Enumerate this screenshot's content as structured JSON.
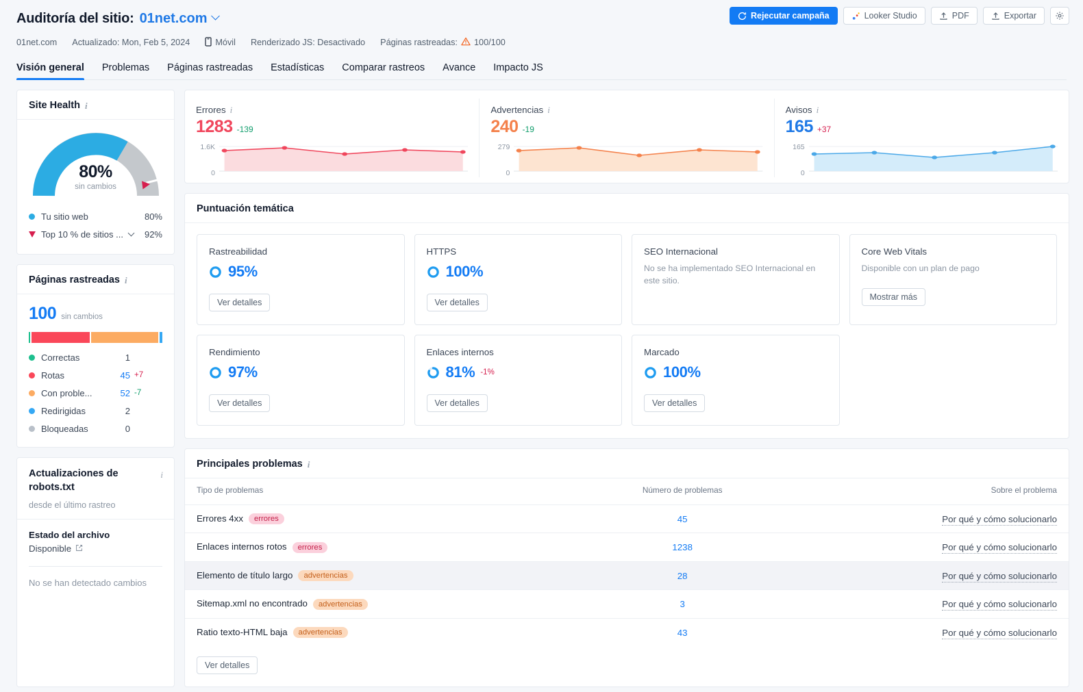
{
  "header": {
    "title": "Auditoría del sitio:",
    "domain": "01net.com",
    "meta": {
      "site": "01net.com",
      "updated": "Actualizado: Mon, Feb 5, 2024",
      "device": "Móvil",
      "js": "Renderizado JS: Desactivado",
      "crawled_label": "Páginas rastreadas:",
      "crawled_value": "100/100"
    },
    "toolbar": {
      "rerun": "Rejecutar campaña",
      "looker": "Looker Studio",
      "pdf": "PDF",
      "export": "Exportar"
    },
    "tabs": [
      {
        "label": "Visión general",
        "active": true
      },
      {
        "label": "Problemas",
        "active": false
      },
      {
        "label": "Páginas rastreadas",
        "active": false
      },
      {
        "label": "Estadísticas",
        "active": false
      },
      {
        "label": "Comparar rastreos",
        "active": false
      },
      {
        "label": "Avance",
        "active": false
      },
      {
        "label": "Impacto JS",
        "active": false
      }
    ]
  },
  "site_health": {
    "title": "Site Health",
    "value": "80%",
    "subtitle": "sin cambios",
    "percent": 80,
    "benchmark_percent": 92,
    "legend": [
      {
        "label": "Tu sitio web",
        "value": "80%",
        "color": "#2cace3",
        "marker": "dot"
      },
      {
        "label": "Top 10 % de sitios ...",
        "value": "92%",
        "color": "#d61f4e",
        "marker": "triangle"
      }
    ]
  },
  "crawled_pages": {
    "title": "Páginas rastreadas",
    "total": "100",
    "subtitle": "sin cambios",
    "segments": [
      {
        "label": "Correctas",
        "value": "1",
        "delta": "",
        "color": "#1dbf8e",
        "pct": 1
      },
      {
        "label": "Rotas",
        "value": "45",
        "delta": "+7",
        "delta_dir": "up",
        "color": "#fa4759",
        "pct": 45
      },
      {
        "label": "Con proble...",
        "value": "52",
        "delta": "-7",
        "delta_dir": "down",
        "color": "#fcab62",
        "pct": 52
      },
      {
        "label": "Redirigidas",
        "value": "2",
        "delta": "",
        "color": "#35a8f4",
        "pct": 2
      },
      {
        "label": "Bloqueadas",
        "value": "0",
        "delta": "",
        "color": "#b9c0c9",
        "pct": 0
      }
    ]
  },
  "robots": {
    "title": "Actualizaciones de robots.txt",
    "subtitle": "desde el último rastreo",
    "status_label": "Estado del archivo",
    "status_value": "Disponible",
    "note": "No se han detectado cambios"
  },
  "metrics": [
    {
      "label": "Errores",
      "value": "1283",
      "delta": "-139",
      "delta_dir": "down",
      "color": "#f0465c",
      "fill": "#fbdcdf",
      "axis_top": "1.6K",
      "axis_bottom": "0"
    },
    {
      "label": "Advertencias",
      "value": "240",
      "delta": "-19",
      "delta_dir": "down",
      "color": "#f4814b",
      "fill": "#fde4d1",
      "axis_top": "279",
      "axis_bottom": "0"
    },
    {
      "label": "Avisos",
      "value": "165",
      "delta": "+37",
      "delta_dir": "up",
      "color": "#4aa8e8",
      "fill": "#d4ecfa",
      "axis_top": "165",
      "axis_bottom": "0"
    }
  ],
  "chart_data": [
    {
      "type": "line",
      "title": "Errores",
      "ylabel": "",
      "xlabel": "",
      "ylim": [
        0,
        1600
      ],
      "tick_labels": [
        "1.6K",
        "0"
      ],
      "grid": false,
      "series": [
        {
          "name": "Errores",
          "values": [
            1400,
            1510,
            1300,
            1420,
            1283
          ],
          "color": "#f0465c"
        }
      ]
    },
    {
      "type": "line",
      "title": "Advertencias",
      "ylabel": "",
      "xlabel": "",
      "ylim": [
        0,
        279
      ],
      "tick_labels": [
        "279",
        "0"
      ],
      "grid": false,
      "series": [
        {
          "name": "Advertencias",
          "values": [
            249,
            262,
            215,
            250,
            240
          ],
          "color": "#f4814b"
        }
      ]
    },
    {
      "type": "line",
      "title": "Avisos",
      "ylabel": "",
      "xlabel": "",
      "ylim": [
        0,
        165
      ],
      "tick_labels": [
        "165",
        "0"
      ],
      "grid": false,
      "series": [
        {
          "name": "Avisos",
          "values": [
            118,
            126,
            92,
            124,
            165
          ],
          "color": "#4aa8e8"
        }
      ]
    }
  ],
  "themes": {
    "title": "Puntuación temática",
    "cards": [
      {
        "name": "Rastreabilidad",
        "score": "95%",
        "percent": 95,
        "delta": "",
        "button": "Ver detalles",
        "desc": ""
      },
      {
        "name": "HTTPS",
        "score": "100%",
        "percent": 100,
        "delta": "",
        "button": "Ver detalles",
        "desc": ""
      },
      {
        "name": "SEO Internacional",
        "score": "",
        "percent": 0,
        "delta": "",
        "button": "",
        "desc": "No se ha implementado SEO Internacional en este sitio."
      },
      {
        "name": "Core Web Vitals",
        "score": "",
        "percent": 0,
        "delta": "",
        "button": "Mostrar más",
        "desc": "Disponible con un plan de pago"
      },
      {
        "name": "Rendimiento",
        "score": "97%",
        "percent": 97,
        "delta": "",
        "button": "Ver detalles",
        "desc": ""
      },
      {
        "name": "Enlaces internos",
        "score": "81%",
        "percent": 81,
        "delta": "-1%",
        "delta_dir": "up",
        "button": "Ver detalles",
        "desc": ""
      },
      {
        "name": "Marcado",
        "score": "100%",
        "percent": 100,
        "delta": "",
        "button": "Ver detalles",
        "desc": ""
      }
    ]
  },
  "issues": {
    "title": "Principales problemas",
    "columns": {
      "type": "Tipo de problemas",
      "count": "Número de problemas",
      "about": "Sobre el problema"
    },
    "rows": [
      {
        "name": "Errores 4xx",
        "tag": "errores",
        "tag_kind": "err",
        "count": "45",
        "link": "Por qué y cómo solucionarlo",
        "alt": false
      },
      {
        "name": "Enlaces internos rotos",
        "tag": "errores",
        "tag_kind": "err",
        "count": "1238",
        "link": "Por qué y cómo solucionarlo",
        "alt": false
      },
      {
        "name": "Elemento de título largo",
        "tag": "advertencias",
        "tag_kind": "warn",
        "count": "28",
        "link": "Por qué y cómo solucionarlo",
        "alt": true
      },
      {
        "name": "Sitemap.xml no encontrado",
        "tag": "advertencias",
        "tag_kind": "warn",
        "count": "3",
        "link": "Por qué y cómo solucionarlo",
        "alt": false
      },
      {
        "name": "Ratio texto-HTML baja",
        "tag": "advertencias",
        "tag_kind": "warn",
        "count": "43",
        "link": "Por qué y cómo solucionarlo",
        "alt": false
      }
    ],
    "footer_button": "Ver detalles"
  }
}
